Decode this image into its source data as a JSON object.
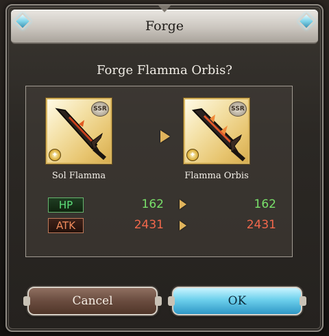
{
  "dialog": {
    "title": "Forge",
    "question": "Forge Flamma Orbis?"
  },
  "source_weapon": {
    "name": "Sol Flamma",
    "rarity": "SSR",
    "element_icon": "light-element-icon"
  },
  "target_weapon": {
    "name": "Flamma Orbis",
    "rarity": "SSR",
    "element_icon": "light-element-icon"
  },
  "stats": {
    "hp": {
      "label": "HP",
      "before": "162",
      "after": "162",
      "color": "#79e06a"
    },
    "atk": {
      "label": "ATK",
      "before": "2431",
      "after": "2431",
      "color": "#f3684c"
    }
  },
  "buttons": {
    "cancel": "Cancel",
    "ok": "OK"
  },
  "colors": {
    "accent_gem": "#7fd3e8",
    "card_gold": "#e7c46e",
    "ok_button": "#6dd0ec",
    "cancel_button": "#6a4c3f"
  }
}
